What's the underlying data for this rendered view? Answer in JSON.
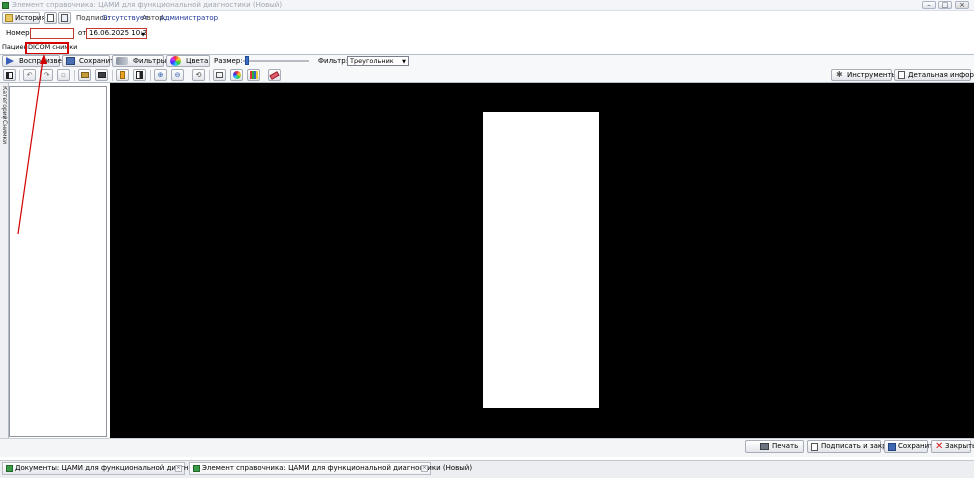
{
  "window": {
    "title": "Элемент справочника: ЦАМИ для функциональной диагностики (Новый)",
    "min": "▭",
    "max": "▭",
    "close": "✕"
  },
  "header": {
    "history_label": "История",
    "signature_label": "Подпись:",
    "signature_value": "Отсутствует",
    "author_label": "Автор:",
    "author_value": "Администратор",
    "number_label": "Номер:",
    "number_value": "",
    "date_prefix": "от",
    "date_value": "16.06.2025 10:2€"
  },
  "tabs": {
    "patient": "Пациент",
    "dicom": "DICOM снимки"
  },
  "toolbar": {
    "play": "Воспроизвести",
    "save": "Сохранить",
    "filters": "Фильтры",
    "colors": "Цвета",
    "size_label": "Размер:",
    "filter_label": "Фильтр:",
    "filter_value": "Треугольник",
    "size_level": 0.05,
    "instruments": "Инструменты",
    "details": "Детальная информация"
  },
  "side_tabs": {
    "categories": "Категории",
    "snapshots": "Снимки"
  },
  "footer": {
    "print": "Печать",
    "sign_close": "Подписать и закрыть",
    "save": "Сохранить",
    "close": "Закрыть"
  },
  "taskbar": {
    "docs": "Документы: ЦАМИ для функциональной диагностики",
    "element": "Элемент справочника: ЦАМИ для функциональной диагностики (Новый)"
  },
  "colors": {
    "accent_red": "#d40000",
    "viewer_bg": "#000000",
    "label_blue": "#1f3a99"
  }
}
